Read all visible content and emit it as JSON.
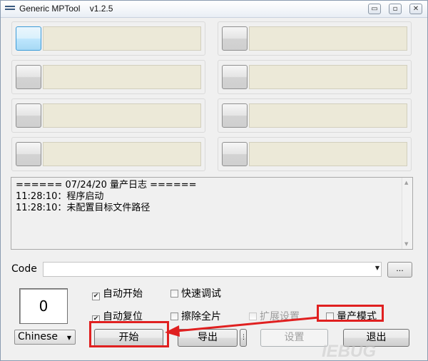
{
  "window": {
    "title": "Generic MPTool    v1.2.5",
    "controls": {
      "minimize": "▭",
      "maximize": "▫",
      "close": "✕"
    }
  },
  "ports": [
    {
      "active": true
    },
    {
      "active": false
    },
    {
      "active": false
    },
    {
      "active": false
    },
    {
      "active": false
    },
    {
      "active": false
    },
    {
      "active": false
    },
    {
      "active": false
    }
  ],
  "log": {
    "lines": [
      "====== 07/24/20 量产日志 ======",
      "11:28:10：程序启动",
      "11:28:10：未配置目标文件路径"
    ]
  },
  "code": {
    "label": "Code",
    "value": "",
    "browse_label": "..."
  },
  "counter": {
    "value": "0"
  },
  "options": {
    "auto_start": {
      "label": "自动开始",
      "checked": true
    },
    "quick_debug": {
      "label": "快速调试",
      "checked": false
    },
    "auto_reset": {
      "label": "自动复位",
      "checked": true
    },
    "erase_all": {
      "label": "擦除全片",
      "checked": false
    },
    "extended_settings": {
      "label": "扩展设置",
      "checked": false,
      "disabled": true
    },
    "mass_production_mode": {
      "label": "量产模式",
      "checked": false
    }
  },
  "language": {
    "selected": "Chinese"
  },
  "buttons": {
    "start": "开始",
    "export": "导出",
    "settings": "设置",
    "exit": "退出"
  },
  "annotation": {
    "color": "#e02020"
  },
  "watermark": "IEBUG"
}
